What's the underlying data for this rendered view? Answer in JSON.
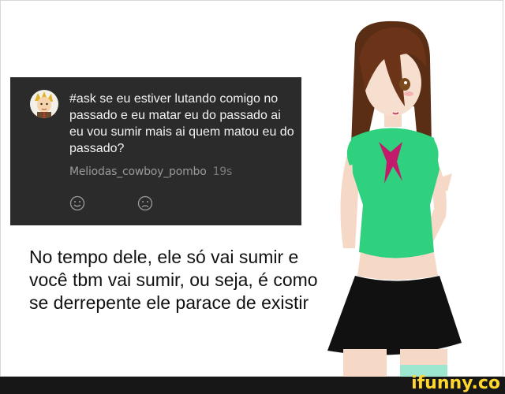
{
  "ask_card": {
    "question": "#ask se eu estiver lutando comigo no passado e eu matar eu do passado ai eu vou sumir mais ai quem matou eu do passado?",
    "username": "Meliodas_cowboy_pombo",
    "time": "19s",
    "reactions": [
      "smile-icon",
      "frown-icon"
    ]
  },
  "answer_text": "No tempo dele, ele só vai sumir e você tbm vai sumir, ou seja, é como se derrepente ele parace de existir",
  "watermark": "ifunny.co",
  "colors": {
    "card_bg": "#2b2b2b",
    "brand_yellow": "#ffd52e",
    "shirt_green": "#2fd07e",
    "skirt_black": "#111111"
  }
}
